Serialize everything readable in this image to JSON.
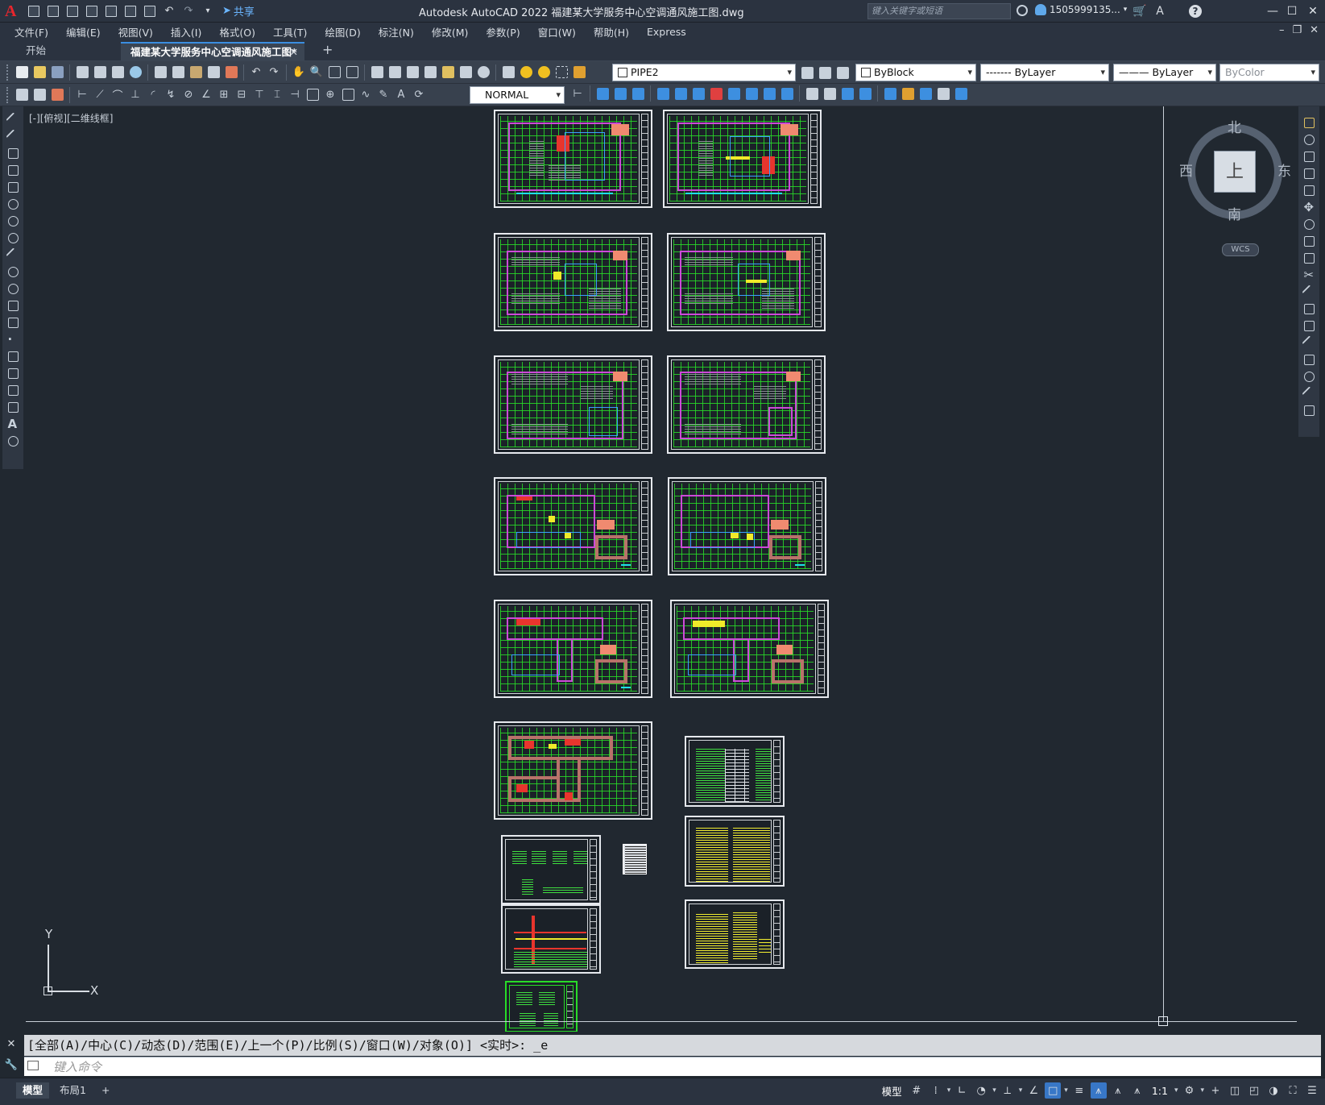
{
  "window": {
    "title": "Autodesk AutoCAD 2022    福建某大学服务中心空调通风施工图.dwg",
    "share_label": "共享",
    "search_placeholder": "键入关键字或短语",
    "user_name": "1505999135...",
    "help_glyph": "?"
  },
  "menu": {
    "items": [
      "文件(F)",
      "编辑(E)",
      "视图(V)",
      "插入(I)",
      "格式(O)",
      "工具(T)",
      "绘图(D)",
      "标注(N)",
      "修改(M)",
      "参数(P)",
      "窗口(W)",
      "帮助(H)",
      "Express"
    ]
  },
  "tabs": {
    "start": "开始",
    "active": "福建某大学服务中心空调通风施工图*",
    "close_glyph": "✕",
    "add_glyph": "+"
  },
  "toolbar": {
    "layer_name": "PIPE2",
    "color": "ByBlock",
    "linetype": "ByLayer",
    "lineweight": "ByLayer",
    "plotstyle": "ByColor",
    "linetype_preview": "-------",
    "lineweight_preview": "———",
    "text_style": "NORMAL"
  },
  "viewport": {
    "label": "[-][俯视][二维线框]",
    "viewcube": {
      "north": "北",
      "south": "南",
      "east": "东",
      "west": "西",
      "face": "上",
      "wcs": "WCS"
    },
    "ucs": {
      "x": "X",
      "y": "Y"
    }
  },
  "command": {
    "history_line": "[全部(A)/中心(C)/动态(D)/范围(E)/上一个(P)/比例(S)/窗口(W)/对象(O)] <实时>: _e",
    "input_placeholder": "键入命令"
  },
  "status": {
    "layouts": [
      "模型",
      "布局1"
    ],
    "add_layout": "+",
    "model_label": "模型",
    "scale": "1:1"
  },
  "colors": {
    "accent": "#3877c7",
    "background": "#212830",
    "drawing_green": "#28dc28",
    "drawing_magenta": "#cc4ad8",
    "brand_red": "#e8262d"
  }
}
